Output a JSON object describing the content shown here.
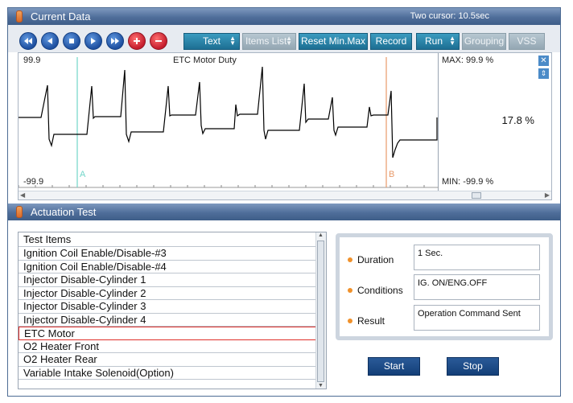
{
  "current_data": {
    "title": "Current Data",
    "cursor_info": "Two cursor: 10.5sec",
    "toolbar": {
      "text_select": "Text",
      "items_list_select": "Items List",
      "reset_label": "Reset Min.Max",
      "record_label": "Record",
      "run_select": "Run",
      "grouping_label": "Grouping",
      "vss_label": "VSS"
    },
    "graph": {
      "chart_title": "ETC Motor Duty",
      "y_max_label": "99.9",
      "y_min_label": "-99.9",
      "cursor_a": "A",
      "cursor_b": "B",
      "max_label": "MAX:  99.9 %",
      "min_label": "MIN:  -99.9 %",
      "current_value": "17.8 %",
      "colors": {
        "cursor_a": "#72d6c9",
        "cursor_b": "#e89a6a",
        "trace": "#000000"
      }
    }
  },
  "actuation": {
    "title": "Actuation Test",
    "list_header": "Test Items",
    "items": [
      "Ignition Coil Enable/Disable-#3",
      "Ignition Coil Enable/Disable-#4",
      "Injector Disable-Cylinder 1",
      "Injector Disable-Cylinder 2",
      "Injector Disable-Cylinder 3",
      "Injector Disable-Cylinder 4",
      "ETC Motor",
      "O2 Heater Front",
      "O2 Heater Rear",
      "Variable Intake Solenoid(Option)"
    ],
    "selected_item": "ETC Motor",
    "duration_label": "Duration",
    "duration_value": "1 Sec.",
    "conditions_label": "Conditions",
    "conditions_value": "IG. ON/ENG.OFF",
    "result_label": "Result",
    "result_value": "Operation Command Sent",
    "start_label": "Start",
    "stop_label": "Stop"
  }
}
